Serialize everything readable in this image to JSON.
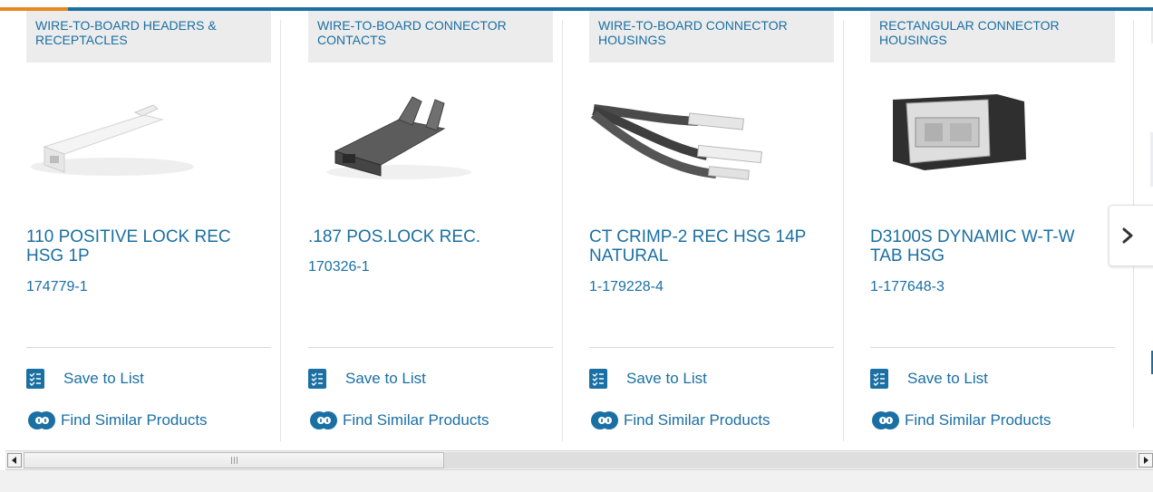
{
  "carousel": {
    "cards": [
      {
        "category": "WIRE-TO-BOARD HEADERS & RECEPTACLES",
        "title": "110 POSITIVE LOCK REC HSG 1P",
        "part_number": "174779-1",
        "save_label": "Save to List",
        "similar_label": "Find Similar Products",
        "image_icon": "white-connector-housing-image"
      },
      {
        "category": "WIRE-TO-BOARD CONNECTOR CONTACTS",
        "title": ".187 POS.LOCK REC.",
        "part_number": "170326-1",
        "save_label": "Save to List",
        "similar_label": "Find Similar Products",
        "image_icon": "crimp-contact-image"
      },
      {
        "category": "WIRE-TO-BOARD CONNECTOR HOUSINGS",
        "title": "CT CRIMP-2 REC HSG 14P NATURAL",
        "part_number": "1-179228-4",
        "save_label": "Save to List",
        "similar_label": "Find Similar Products",
        "image_icon": "ribbon-cable-assembly-image"
      },
      {
        "category": "RECTANGULAR CONNECTOR HOUSINGS",
        "title": "D3100S DYNAMIC W-T-W TAB HSG",
        "part_number": "1-177648-3",
        "save_label": "Save to List",
        "similar_label": "Find Similar Products",
        "image_icon": "rectangular-housing-image"
      }
    ],
    "next_icon": "chevron-right-icon"
  },
  "colors": {
    "accent": "#1a6fa3",
    "highlight": "#e8871e",
    "category_bg": "#ececec"
  },
  "scrollbar": {
    "left_icon": "scroll-left-arrow-icon",
    "right_icon": "scroll-right-arrow-icon",
    "thumb_icon": "scroll-thumb-grip-icon"
  }
}
